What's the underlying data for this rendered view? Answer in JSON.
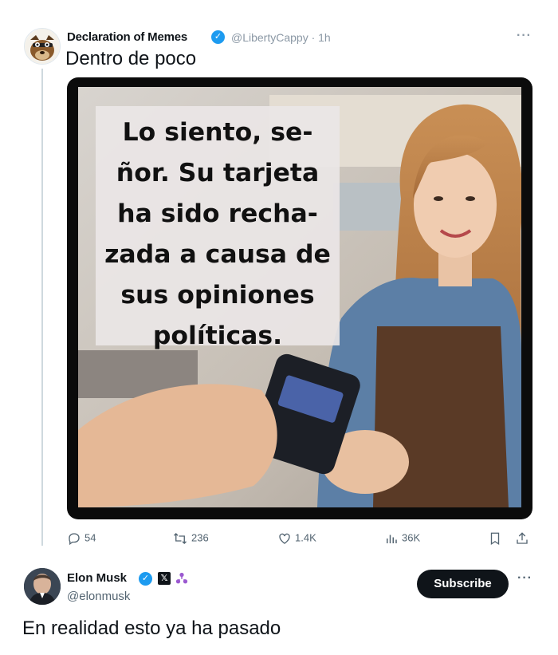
{
  "tweet1": {
    "display_name": "Declaration of Memes",
    "handle_time": "@LibertyCappy · 1h",
    "more": "···",
    "text": "Dentro de poco",
    "meme_caption": [
      "Lo siento, se-",
      "ñor. Su tarjeta",
      "ha sido recha-",
      "zada a causa de",
      "sus opiniones",
      "políticas."
    ]
  },
  "stats": {
    "replies": "54",
    "retweets": "236",
    "likes": "1.4K",
    "views": "36K"
  },
  "tweet2": {
    "display_name": "Elon Musk",
    "x_badge": "𝕏",
    "handle": "@elonmusk",
    "subscribe_label": "Subscribe",
    "more": "···",
    "text": "En realidad esto ya ha pasado"
  },
  "colors": {
    "verified": "#1d9bf0",
    "muted": "#536471",
    "text": "#0f1419"
  }
}
